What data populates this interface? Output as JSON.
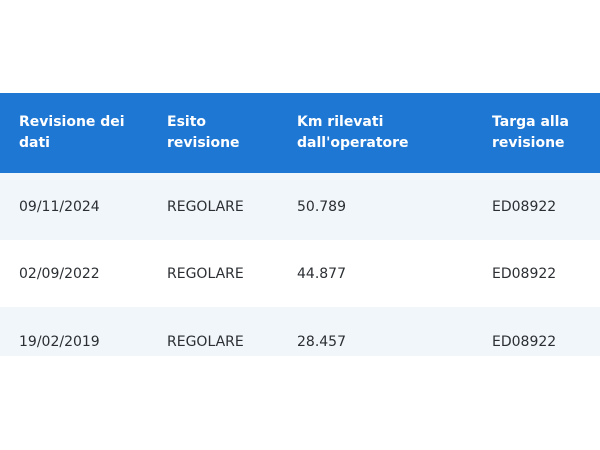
{
  "table": {
    "headers": [
      [
        "Revisione dei",
        "dati"
      ],
      [
        "Esito",
        "revisione"
      ],
      [
        "Km rilevati",
        "dall'operatore"
      ],
      [
        "Targa alla",
        "revisione"
      ]
    ],
    "rows": [
      [
        "09/11/2024",
        "REGOLARE",
        "50.789",
        "ED08922"
      ],
      [
        "02/09/2022",
        "REGOLARE",
        "44.877",
        "ED08922"
      ],
      [
        "19/02/2019",
        "REGOLARE",
        "28.457",
        "ED08922"
      ]
    ]
  },
  "colors": {
    "header_bg": "#1f77d4",
    "header_text": "#ffffff",
    "row_alt_bg": "#f1f6fa",
    "cell_text": "#2b2f33"
  }
}
